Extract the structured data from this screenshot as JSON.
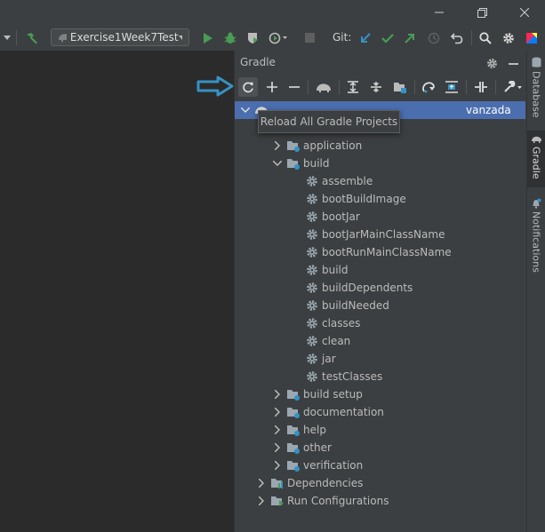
{
  "toolbar": {
    "run_config": "Exercise1Week7Test",
    "git_label": "Git:"
  },
  "gradle": {
    "title": "Gradle",
    "tooltip": "Reload All Gradle Projects",
    "root_label": "Reload All Gradle Projects",
    "root_visible_tail": "vanzada",
    "tasks_groups": [
      {
        "label": "application",
        "expanded": false
      },
      {
        "label": "build",
        "expanded": true
      }
    ],
    "build_tasks": [
      "assemble",
      "bootBuildImage",
      "bootJar",
      "bootJarMainClassName",
      "bootRunMainClassName",
      "build",
      "buildDependents",
      "buildNeeded",
      "classes",
      "clean",
      "jar",
      "testClasses"
    ],
    "more_groups": [
      "build setup",
      "documentation",
      "help",
      "other",
      "verification"
    ],
    "dependencies": "Dependencies",
    "run_configurations": "Run Configurations"
  },
  "right_strip": {
    "database": "Database",
    "gradle": "Gradle",
    "notifications": "Notifications"
  },
  "colors": {
    "selection": "#4b6eaf",
    "accent_arrow": "#3592c4",
    "run_green": "#499c54"
  }
}
